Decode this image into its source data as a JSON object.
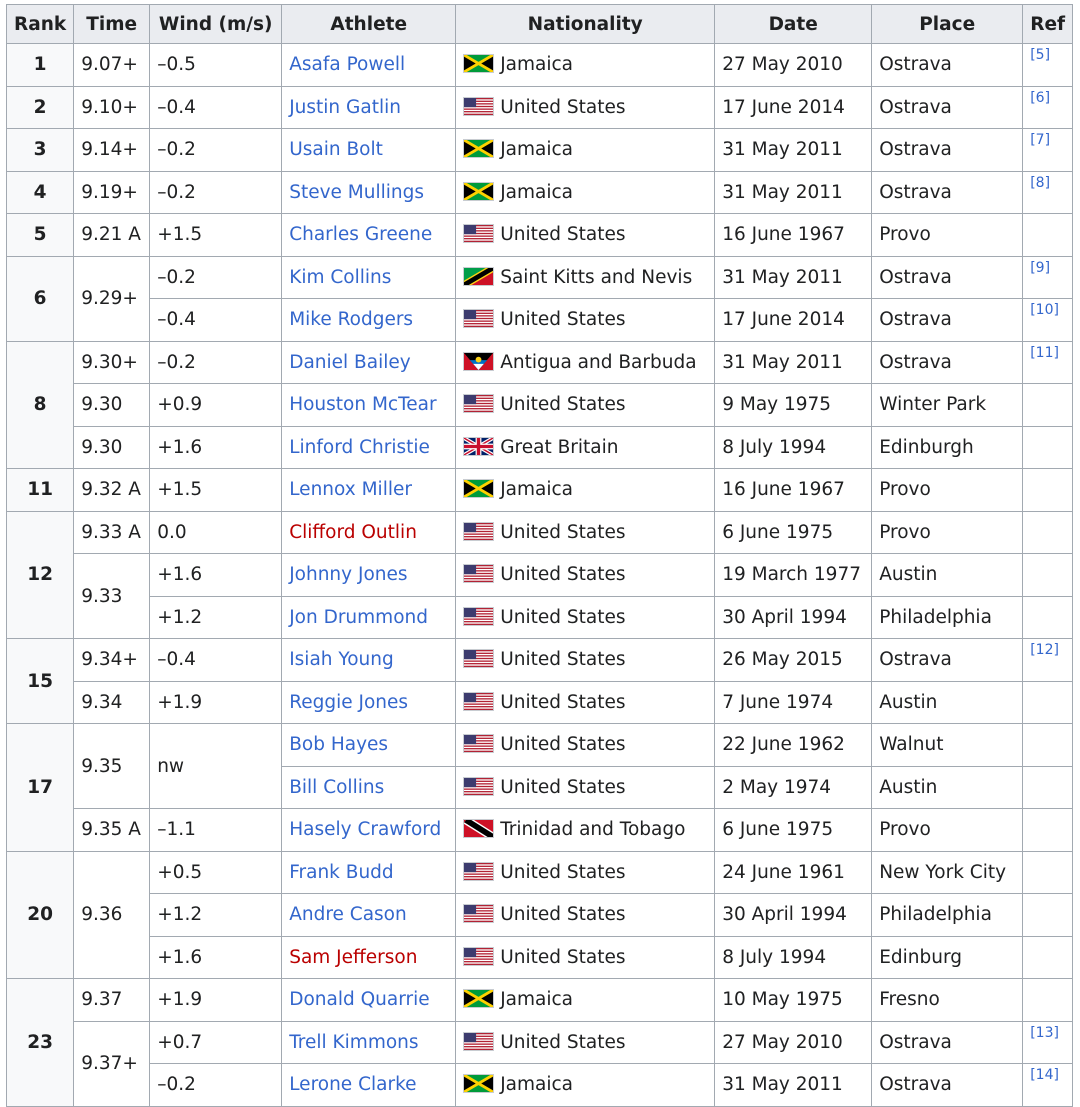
{
  "headers": [
    "Rank",
    "Time",
    "Wind (m/s)",
    "Athlete",
    "Nationality",
    "Date",
    "Place",
    "Ref"
  ],
  "rows": [
    {
      "rank": "1",
      "rank_span": 1,
      "time": "9.07+",
      "time_span": 1,
      "wind": "–0.5",
      "wind_span": 1,
      "athlete": "Asafa Powell",
      "red": false,
      "flag": "jamaica-flag",
      "nationality": "Jamaica",
      "date": "27 May 2010",
      "place": "Ostrava",
      "ref": "[5]"
    },
    {
      "rank": "2",
      "rank_span": 1,
      "time": "9.10+",
      "time_span": 1,
      "wind": "–0.4",
      "wind_span": 1,
      "athlete": "Justin Gatlin",
      "red": false,
      "flag": "us-flag",
      "nationality": "United States",
      "date": "17 June 2014",
      "place": "Ostrava",
      "ref": "[6]"
    },
    {
      "rank": "3",
      "rank_span": 1,
      "time": "9.14+",
      "time_span": 1,
      "wind": "–0.2",
      "wind_span": 1,
      "athlete": "Usain Bolt",
      "red": false,
      "flag": "jamaica-flag",
      "nationality": "Jamaica",
      "date": "31 May 2011",
      "place": "Ostrava",
      "ref": "[7]"
    },
    {
      "rank": "4",
      "rank_span": 1,
      "time": "9.19+",
      "time_span": 1,
      "wind": "–0.2",
      "wind_span": 1,
      "athlete": "Steve Mullings",
      "red": false,
      "flag": "jamaica-flag",
      "nationality": "Jamaica",
      "date": "31 May 2011",
      "place": "Ostrava",
      "ref": "[8]"
    },
    {
      "rank": "5",
      "rank_span": 1,
      "time": "9.21 A",
      "time_span": 1,
      "wind": "+1.5",
      "wind_span": 1,
      "athlete": "Charles Greene",
      "red": false,
      "flag": "us-flag",
      "nationality": "United States",
      "date": "16 June 1967",
      "place": "Provo",
      "ref": ""
    },
    {
      "rank": "6",
      "rank_span": 2,
      "time": "9.29+",
      "time_span": 2,
      "wind": "–0.2",
      "wind_span": 1,
      "athlete": "Kim Collins",
      "red": false,
      "flag": "saint-kitts-flag",
      "nationality": "Saint Kitts and Nevis",
      "date": "31 May 2011",
      "place": "Ostrava",
      "ref": "[9]"
    },
    {
      "rank": null,
      "rank_span": 0,
      "time": null,
      "time_span": 0,
      "wind": "–0.4",
      "wind_span": 1,
      "athlete": "Mike Rodgers",
      "red": false,
      "flag": "us-flag",
      "nationality": "United States",
      "date": "17 June 2014",
      "place": "Ostrava",
      "ref": "[10]"
    },
    {
      "rank": "8",
      "rank_span": 3,
      "time": "9.30+",
      "time_span": 1,
      "wind": "–0.2",
      "wind_span": 1,
      "athlete": "Daniel Bailey",
      "red": false,
      "flag": "antigua-flag",
      "nationality": "Antigua and Barbuda",
      "date": "31 May 2011",
      "place": "Ostrava",
      "ref": "[11]"
    },
    {
      "rank": null,
      "rank_span": 0,
      "time": "9.30",
      "time_span": 1,
      "wind": "+0.9",
      "wind_span": 1,
      "athlete": "Houston McTear",
      "red": false,
      "flag": "us-flag",
      "nationality": "United States",
      "date": "9 May 1975",
      "place": "Winter Park",
      "ref": ""
    },
    {
      "rank": null,
      "rank_span": 0,
      "time": "9.30",
      "time_span": 1,
      "wind": "+1.6",
      "wind_span": 1,
      "athlete": "Linford Christie",
      "red": false,
      "flag": "uk-flag",
      "nationality": "Great Britain",
      "date": "8 July 1994",
      "place": "Edinburgh",
      "ref": ""
    },
    {
      "rank": "11",
      "rank_span": 1,
      "time": "9.32 A",
      "time_span": 1,
      "wind": "+1.5",
      "wind_span": 1,
      "athlete": "Lennox Miller",
      "red": false,
      "flag": "jamaica-flag",
      "nationality": "Jamaica",
      "date": "16 June 1967",
      "place": "Provo",
      "ref": ""
    },
    {
      "rank": "12",
      "rank_span": 3,
      "time": "9.33 A",
      "time_span": 1,
      "wind": "0.0",
      "wind_span": 1,
      "athlete": "Clifford Outlin",
      "red": true,
      "flag": "us-flag",
      "nationality": "United States",
      "date": "6 June 1975",
      "place": "Provo",
      "ref": ""
    },
    {
      "rank": null,
      "rank_span": 0,
      "time": "9.33",
      "time_span": 2,
      "wind": "+1.6",
      "wind_span": 1,
      "athlete": "Johnny Jones",
      "red": false,
      "flag": "us-flag",
      "nationality": "United States",
      "date": "19 March 1977",
      "place": "Austin",
      "ref": ""
    },
    {
      "rank": null,
      "rank_span": 0,
      "time": null,
      "time_span": 0,
      "wind": "+1.2",
      "wind_span": 1,
      "athlete": "Jon Drummond",
      "red": false,
      "flag": "us-flag",
      "nationality": "United States",
      "date": "30 April 1994",
      "place": "Philadelphia",
      "ref": ""
    },
    {
      "rank": "15",
      "rank_span": 2,
      "time": "9.34+",
      "time_span": 1,
      "wind": "–0.4",
      "wind_span": 1,
      "athlete": "Isiah Young",
      "red": false,
      "flag": "us-flag",
      "nationality": "United States",
      "date": "26 May 2015",
      "place": "Ostrava",
      "ref": "[12]"
    },
    {
      "rank": null,
      "rank_span": 0,
      "time": "9.34",
      "time_span": 1,
      "wind": "+1.9",
      "wind_span": 1,
      "athlete": "Reggie Jones",
      "red": false,
      "flag": "us-flag",
      "nationality": "United States",
      "date": "7 June 1974",
      "place": "Austin",
      "ref": ""
    },
    {
      "rank": "17",
      "rank_span": 3,
      "time": "9.35",
      "time_span": 2,
      "wind": "nw",
      "wind_span": 2,
      "athlete": "Bob Hayes",
      "red": false,
      "flag": "us-flag",
      "nationality": "United States",
      "date": "22 June 1962",
      "place": "Walnut",
      "ref": ""
    },
    {
      "rank": null,
      "rank_span": 0,
      "time": null,
      "time_span": 0,
      "wind": null,
      "wind_span": 0,
      "athlete": "Bill Collins",
      "red": false,
      "flag": "us-flag",
      "nationality": "United States",
      "date": "2 May 1974",
      "place": "Austin",
      "ref": ""
    },
    {
      "rank": null,
      "rank_span": 0,
      "time": "9.35 A",
      "time_span": 1,
      "wind": "–1.1",
      "wind_span": 1,
      "athlete": "Hasely Crawford",
      "red": false,
      "flag": "trinidad-flag",
      "nationality": "Trinidad and Tobago",
      "date": "6 June 1975",
      "place": "Provo",
      "ref": ""
    },
    {
      "rank": "20",
      "rank_span": 3,
      "time": "9.36",
      "time_span": 3,
      "wind": "+0.5",
      "wind_span": 1,
      "athlete": "Frank Budd",
      "red": false,
      "flag": "us-flag",
      "nationality": "United States",
      "date": "24 June 1961",
      "place": "New York City",
      "ref": ""
    },
    {
      "rank": null,
      "rank_span": 0,
      "time": null,
      "time_span": 0,
      "wind": "+1.2",
      "wind_span": 1,
      "athlete": "Andre Cason",
      "red": false,
      "flag": "us-flag",
      "nationality": "United States",
      "date": "30 April 1994",
      "place": "Philadelphia",
      "ref": ""
    },
    {
      "rank": null,
      "rank_span": 0,
      "time": null,
      "time_span": 0,
      "wind": "+1.6",
      "wind_span": 1,
      "athlete": "Sam Jefferson",
      "red": true,
      "flag": "us-flag",
      "nationality": "United States",
      "date": "8 July 1994",
      "place": "Edinburg",
      "ref": ""
    },
    {
      "rank": "23",
      "rank_span": 3,
      "time": "9.37",
      "time_span": 1,
      "wind": "+1.9",
      "wind_span": 1,
      "athlete": "Donald Quarrie",
      "red": false,
      "flag": "jamaica-flag",
      "nationality": "Jamaica",
      "date": "10 May 1975",
      "place": "Fresno",
      "ref": ""
    },
    {
      "rank": null,
      "rank_span": 0,
      "time": "9.37+",
      "time_span": 2,
      "wind": "+0.7",
      "wind_span": 1,
      "athlete": "Trell Kimmons",
      "red": false,
      "flag": "us-flag",
      "nationality": "United States",
      "date": "27 May 2010",
      "place": "Ostrava",
      "ref": "[13]"
    },
    {
      "rank": null,
      "rank_span": 0,
      "time": null,
      "time_span": 0,
      "wind": "–0.2",
      "wind_span": 1,
      "athlete": "Lerone Clarke",
      "red": false,
      "flag": "jamaica-flag",
      "nationality": "Jamaica",
      "date": "31 May 2011",
      "place": "Ostrava",
      "ref": "[14]"
    }
  ],
  "colors": {
    "link": "#3366cc",
    "redlink": "#ba0000",
    "header_bg": "#eaecf0",
    "rank_bg": "#f8f9fa",
    "border": "#a2a9b1"
  }
}
